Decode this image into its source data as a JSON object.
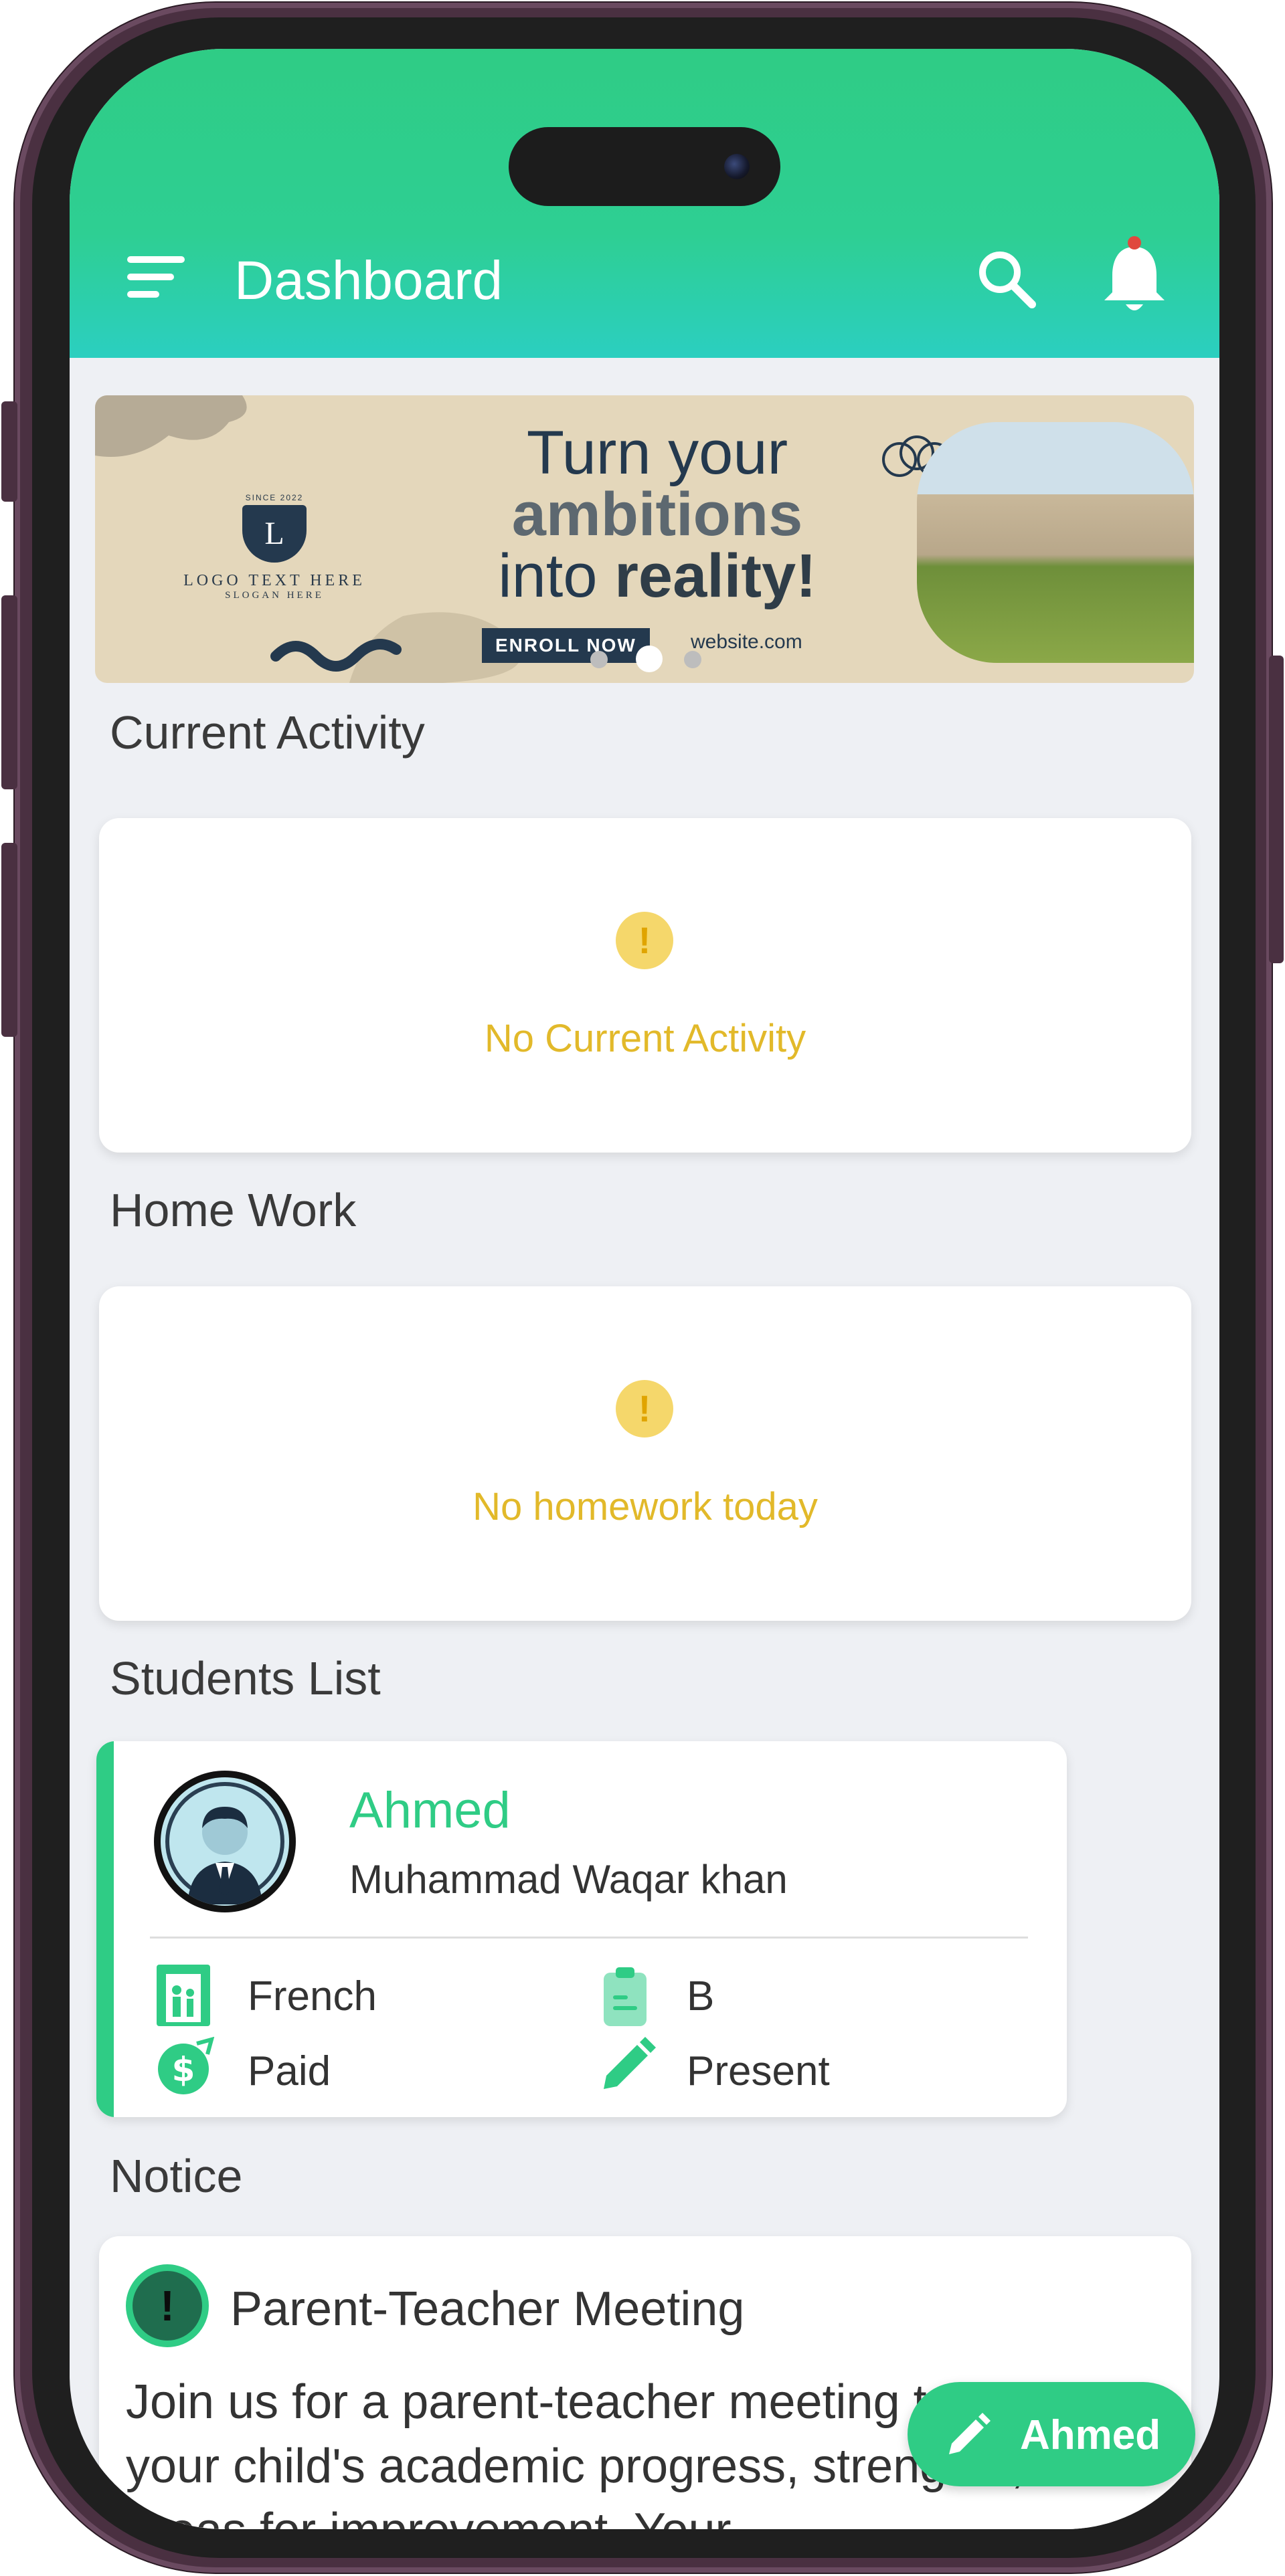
{
  "app_bar": {
    "title": "Dashboard",
    "menu_icon": "menu-icon",
    "search_icon": "search-icon",
    "bell_icon": "bell-icon",
    "gradient": [
      "#2fcc85",
      "#2bcfc0"
    ]
  },
  "banner": {
    "logo_since": "SINCE 2022",
    "logo_letter": "L",
    "logo_text": "LOGO TEXT HERE",
    "logo_slogan": "SLOGAN HERE",
    "headline_line1": "Turn your",
    "headline_line2": "ambitions",
    "headline_line3a": "into ",
    "headline_line3b": "reality!",
    "cta": "ENROLL NOW",
    "website": "website.com",
    "carousel": {
      "count": 3,
      "active_index": 1
    }
  },
  "sections": {
    "current_activity": "Current Activity",
    "homework": "Home Work",
    "students": "Students List",
    "notice": "Notice"
  },
  "current_activity": {
    "empty_icon": "warning-icon",
    "empty_text": "No Current Activity"
  },
  "homework": {
    "empty_icon": "warning-icon",
    "empty_text": "No homework today"
  },
  "student": {
    "name": "Ahmed",
    "parent": "Muhammad Waqar khan",
    "course": "French",
    "grade": "B",
    "fee_status": "Paid",
    "attendance": "Present"
  },
  "notice": {
    "title": "Parent-Teacher Meeting",
    "body": "Join us for a parent-teacher meeting to discuss your child's academic progress, strengths, and areas for improvement. Your"
  },
  "fab": {
    "label": "Ahmed",
    "icon": "pencil-icon"
  },
  "colors": {
    "accent": "#2fcc85",
    "warning": "#e2b92a",
    "background": "#eef0f4"
  }
}
